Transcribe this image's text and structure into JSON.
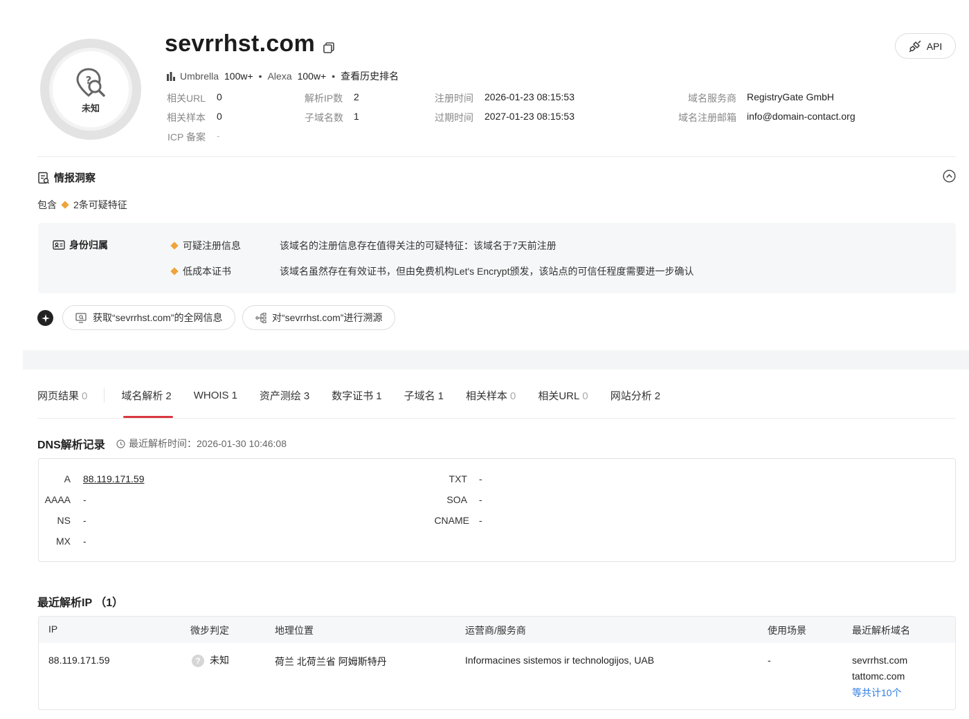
{
  "header": {
    "domain": "sevrrhst.com",
    "verdict": "未知",
    "api_label": "API",
    "rank": {
      "umbrella_label": "Umbrella",
      "umbrella_value": "100w+",
      "alexa_label": "Alexa",
      "alexa_value": "100w+",
      "history_label": "查看历史排名",
      "separator": "•"
    },
    "info": {
      "related_url_label": "相关URL",
      "related_url_value": "0",
      "related_sample_label": "相关样本",
      "related_sample_value": "0",
      "icp_label": "ICP 备案",
      "icp_value": "-",
      "resolved_ip_label": "解析IP数",
      "resolved_ip_value": "2",
      "subdomain_label": "子域名数",
      "subdomain_value": "1",
      "reg_time_label": "注册时间",
      "reg_time_value": "2026-01-23 08:15:53",
      "exp_time_label": "过期时间",
      "exp_time_value": "2027-01-23 08:15:53",
      "registrar_label": "域名服务商",
      "registrar_value": "RegistryGate GmbH",
      "reg_email_label": "域名注册邮箱",
      "reg_email_value": "info@domain-contact.org"
    }
  },
  "intel": {
    "title": "情报洞察",
    "contains_prefix": "包含",
    "contains_text": "2条可疑特征",
    "category": "身份归属",
    "features": [
      {
        "name": "可疑注册信息",
        "desc": "该域名的注册信息存在值得关注的可疑特征：该域名于7天前注册"
      },
      {
        "name": "低成本证书",
        "desc": "该域名虽然存在有效证书，但由免费机构Let's Encrypt颁发，该站点的可信任程度需要进一步确认"
      }
    ],
    "actions": {
      "fetch_label": "获取“sevrrhst.com”的全网信息",
      "trace_label": "对“sevrrhst.com”进行溯源"
    }
  },
  "tabs": [
    {
      "label": "网页结果",
      "count": "0"
    },
    {
      "label": "域名解析",
      "count": "2",
      "active": true
    },
    {
      "label": "WHOIS",
      "count": "1"
    },
    {
      "label": "资产测绘",
      "count": "3"
    },
    {
      "label": "数字证书",
      "count": "1"
    },
    {
      "label": "子域名",
      "count": "1"
    },
    {
      "label": "相关样本",
      "count": "0"
    },
    {
      "label": "相关URL",
      "count": "0"
    },
    {
      "label": "网站分析",
      "count": "2"
    }
  ],
  "dns": {
    "title": "DNS解析记录",
    "time_label": "最近解析时间：2026-01-30 10:46:08",
    "records_left": [
      {
        "type": "A",
        "value": "88.119.171.59"
      },
      {
        "type": "AAAA",
        "value": "-"
      },
      {
        "type": "NS",
        "value": "-"
      },
      {
        "type": "MX",
        "value": "-"
      }
    ],
    "records_right": [
      {
        "type": "TXT",
        "value": "-"
      },
      {
        "type": "SOA",
        "value": "-"
      },
      {
        "type": "CNAME",
        "value": "-"
      }
    ]
  },
  "recent_ip": {
    "title": "最近解析IP （1）",
    "columns": [
      "IP",
      "微步判定",
      "地理位置",
      "运营商/服务商",
      "使用场景",
      "最近解析域名"
    ],
    "rows": [
      {
        "ip": "88.119.171.59",
        "verdict": "未知",
        "location": "荷兰 北荷兰省 阿姆斯特丹",
        "isp": "Informacines sistemos ir technologijos, UAB",
        "scenario": "-",
        "domains": [
          "sevrrhst.com",
          "tattomc.com"
        ],
        "more": "等共计10个"
      }
    ]
  },
  "colors": {
    "accent_red": "#d9363e",
    "warning_orange": "#f0a33a",
    "link_blue": "#2f7de1"
  }
}
